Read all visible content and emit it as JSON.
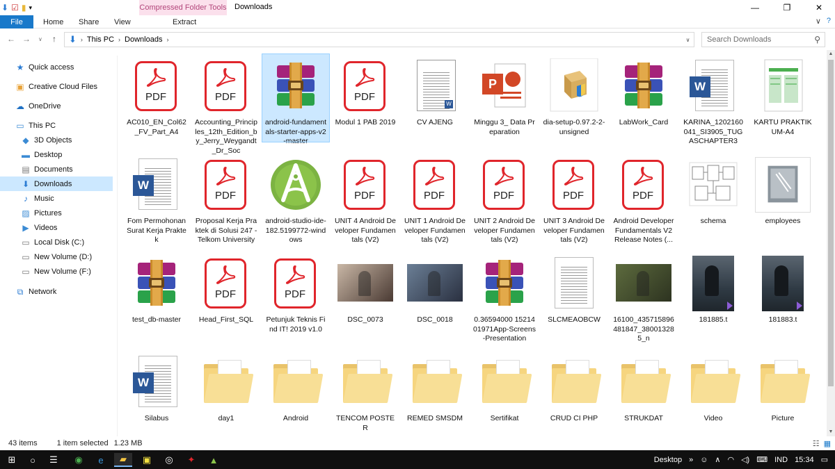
{
  "window": {
    "title": "Downloads",
    "context_tab": "Compressed Folder Tools",
    "minimize_icon": "—",
    "maximize_icon": "❐",
    "close_icon": "✕"
  },
  "ribbon": {
    "tabs": [
      "File",
      "Home",
      "Share",
      "View",
      "Extract"
    ],
    "collapse_icon": "∨",
    "help_icon": "?"
  },
  "address": {
    "path": [
      "This PC",
      "Downloads"
    ],
    "search_placeholder": "Search Downloads"
  },
  "sidebar": {
    "items": [
      {
        "label": "Quick access",
        "icon": "★",
        "color": "#2b7cd3"
      },
      {
        "label": "Creative Cloud Files",
        "icon": "▣",
        "color": "#e8a33a"
      },
      {
        "label": "OneDrive",
        "icon": "☁",
        "color": "#1e70c4"
      },
      {
        "label": "This PC",
        "icon": "▭",
        "color": "#3b8bd4"
      },
      {
        "label": "3D Objects",
        "icon": "◆",
        "color": "#3b8bd4"
      },
      {
        "label": "Desktop",
        "icon": "▬",
        "color": "#3b8bd4"
      },
      {
        "label": "Documents",
        "icon": "▤",
        "color": "#7a7a7a"
      },
      {
        "label": "Downloads",
        "icon": "⬇",
        "color": "#2b7cd3"
      },
      {
        "label": "Music",
        "icon": "♪",
        "color": "#2b7cd3"
      },
      {
        "label": "Pictures",
        "icon": "▨",
        "color": "#3b8bd4"
      },
      {
        "label": "Videos",
        "icon": "▶",
        "color": "#3b8bd4"
      },
      {
        "label": "Local Disk (C:)",
        "icon": "▭",
        "color": "#777"
      },
      {
        "label": "New Volume (D:)",
        "icon": "▭",
        "color": "#777"
      },
      {
        "label": "New Volume (F:)",
        "icon": "▭",
        "color": "#777"
      },
      {
        "label": "Network",
        "icon": "⧉",
        "color": "#2b7cd3"
      }
    ]
  },
  "files": [
    {
      "name": "AC010_EN_Col62_FV_Part_A4",
      "type": "pdf"
    },
    {
      "name": "Accounting_Principles_12th_Edition_by_Jerry_Weygandt_Dr_Soc",
      "type": "pdf"
    },
    {
      "name": "android-fundamentals-starter-apps-v2-master",
      "type": "rar",
      "selected": true
    },
    {
      "name": "Modul 1 PAB 2019",
      "type": "pdf"
    },
    {
      "name": "CV AJENG",
      "type": "docthumb"
    },
    {
      "name": "Minggu 3_ Data Preparation",
      "type": "ppt"
    },
    {
      "name": "dia-setup-0.97.2-2-unsigned",
      "type": "setup"
    },
    {
      "name": "LabWork_Card",
      "type": "rar"
    },
    {
      "name": "KARINA_1202160041_SI3905_TUGASCHAPTER3",
      "type": "word"
    },
    {
      "name": "KARTU PRAKTIKUM-A4",
      "type": "greendoc"
    },
    {
      "name": "Fom Permohonan Surat Kerja Praktek",
      "type": "word"
    },
    {
      "name": "Proposal Kerja Praktek di Solusi 247 - Telkom University",
      "type": "pdf"
    },
    {
      "name": "android-studio-ide-182.5199772-windows",
      "type": "android"
    },
    {
      "name": "UNIT 4 Android Developer Fundamentals (V2)",
      "type": "pdf"
    },
    {
      "name": "UNIT 1 Android Developer Fundamentals (V2)",
      "type": "pdf"
    },
    {
      "name": "UNIT 2 Android Developer Fundamentals (V2)",
      "type": "pdf"
    },
    {
      "name": "UNIT 3 Android Developer Fundamentals (V2)",
      "type": "pdf"
    },
    {
      "name": "Android Developer Fundamentals V2 Release Notes (...",
      "type": "pdf"
    },
    {
      "name": "schema",
      "type": "schema"
    },
    {
      "name": "employees",
      "type": "dbfile"
    },
    {
      "name": "test_db-master",
      "type": "rar"
    },
    {
      "name": "Head_First_SQL",
      "type": "pdf"
    },
    {
      "name": "Petunjuk Teknis Find IT! 2019 v1.0",
      "type": "pdf"
    },
    {
      "name": "DSC_0073",
      "type": "photo",
      "c1": "#c9b7a6",
      "c2": "#4a3a33"
    },
    {
      "name": "DSC_0018",
      "type": "photo",
      "c1": "#6b7f96",
      "c2": "#2a3040"
    },
    {
      "name": "0.36594000 1521401971App-Screens-Presentation",
      "type": "rar"
    },
    {
      "name": "SLCMEAOBCW",
      "type": "plaindoc"
    },
    {
      "name": "16100_435715896481847_380013285_n",
      "type": "photo",
      "c1": "#5d6b3e",
      "c2": "#2d3320"
    },
    {
      "name": "181885.t",
      "type": "video"
    },
    {
      "name": "181883.t",
      "type": "video"
    },
    {
      "name": "Silabus",
      "type": "word"
    },
    {
      "name": "day1",
      "type": "folder"
    },
    {
      "name": "Android",
      "type": "folder"
    },
    {
      "name": "TENCOM POSTER",
      "type": "folder"
    },
    {
      "name": "REMED SMSDM",
      "type": "folder"
    },
    {
      "name": "Sertifikat",
      "type": "folder"
    },
    {
      "name": "CRUD CI PHP",
      "type": "folder"
    },
    {
      "name": "STRUKDAT",
      "type": "folder"
    },
    {
      "name": "Video",
      "type": "folder"
    },
    {
      "name": "Picture",
      "type": "folder"
    }
  ],
  "status": {
    "count": "43 items",
    "selection": "1 item selected",
    "size": "1.23 MB"
  },
  "taskbar": {
    "desktop_label": "Desktop",
    "language": "IND",
    "time": "15:34"
  },
  "colors": {
    "accent": "#1979ca",
    "selection": "#cce8ff",
    "pdf_red": "#e0252b"
  }
}
